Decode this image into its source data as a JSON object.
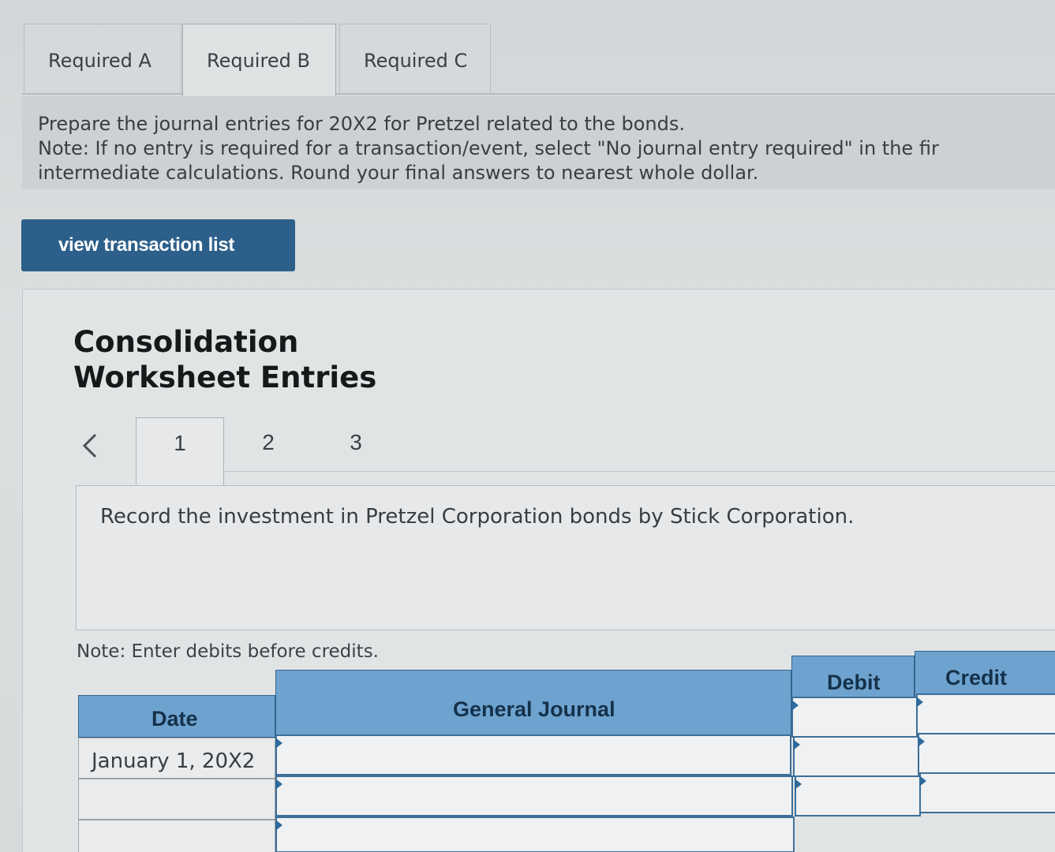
{
  "tabs": [
    {
      "label": "Required A",
      "active": false
    },
    {
      "label": "Required B",
      "active": true
    },
    {
      "label": "Required C",
      "active": false
    }
  ],
  "instructions": {
    "line1": "Prepare the journal entries for 20X2 for Pretzel related to the bonds.",
    "line2": "Note: If no entry is required for a transaction/event, select \"No journal entry required\" in the fir",
    "line3": "intermediate calculations. Round your final answers to nearest whole dollar."
  },
  "view_button": {
    "label": "view transaction list"
  },
  "worksheet": {
    "title_line1": "Consolidation",
    "title_line2": "Worksheet Entries",
    "pages": [
      "1",
      "2",
      "3"
    ],
    "active_page": "1",
    "record_text": "Record the investment in Pretzel Corporation bonds by Stick Corporation.",
    "note": "Note: Enter debits before credits."
  },
  "journal": {
    "headers": {
      "date": "Date",
      "general_journal": "General Journal",
      "debit": "Debit",
      "credit": "Credit"
    },
    "rows": [
      {
        "date": "January 1, 20X2",
        "account": "",
        "debit": "",
        "credit": ""
      },
      {
        "date": "",
        "account": "",
        "debit": "",
        "credit": ""
      },
      {
        "date": "",
        "account": "",
        "debit": "",
        "credit": ""
      }
    ]
  },
  "colors": {
    "tab_button": "#2c5f8a",
    "table_header": "#6fa3cf",
    "table_border": "#3d6f99"
  }
}
